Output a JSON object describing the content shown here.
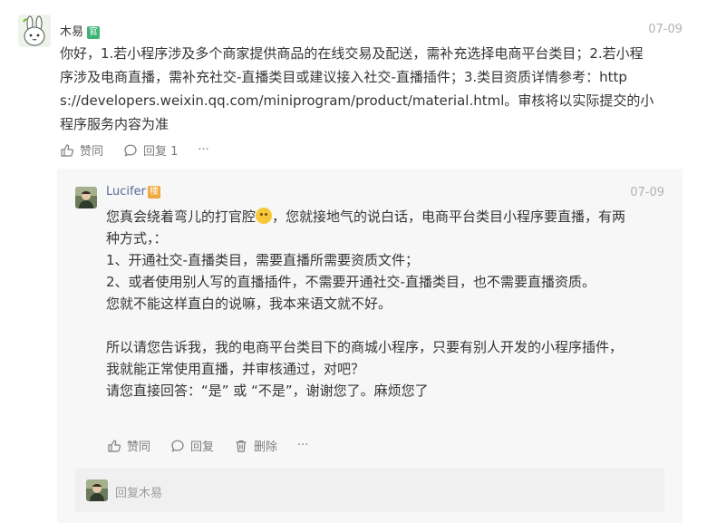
{
  "comment": {
    "author": "木易",
    "badge": "官",
    "date": "07-09",
    "lines": [
      "你好，1.若小程序涉及多个商家提供商品的在线交易及配送，需补充选择电商平台类目；2.若小程",
      "序涉及电商直播，需补充社交-直播类目或建议接入社交-直播插件；3.类目资质详情参考：http",
      "s://developers.weixin.qq.com/miniprogram/product/material.html。审核将以实际提交的小",
      "程序服务内容为准"
    ],
    "actions": {
      "like_label": "赞同",
      "reply_label": "回复 1",
      "more_label": "···"
    }
  },
  "reply": {
    "author": "Lucifer",
    "badge": "楼",
    "date": "07-09",
    "line1_a": "您真会绕着弯儿的打官腔",
    "line1_b": "，您就接地气的说白话，电商平台类目小程序要直播，有两",
    "line2": "种方式，：",
    "line3": "1、开通社交-直播类目，需要直播所需要资质文件；",
    "line4": "2、或者使用别人写的直播插件，不需要开通社交-直播类目，也不需要直播资质。",
    "line5": "您就不能这样直白的说嘛，我本来语文就不好。",
    "line6": "所以请您告诉我，我的电商平台类目下的商城小程序，只要有别人开发的小程序插件，",
    "line7": "我就能正常使用直播，并审核通过，对吧？",
    "line8": "请您直接回答：“是” 或 “不是”，谢谢您了。麻烦您了",
    "actions": {
      "like_label": "赞同",
      "reply_label": "回复",
      "delete_label": "删除",
      "more_label": "···"
    }
  },
  "reply_input": {
    "placeholder": "回复木易"
  },
  "colors": {
    "official_badge": "#3eb575",
    "dev_badge": "#f0a93d",
    "link_name": "#576b95",
    "muted": "#b2b2b2"
  }
}
